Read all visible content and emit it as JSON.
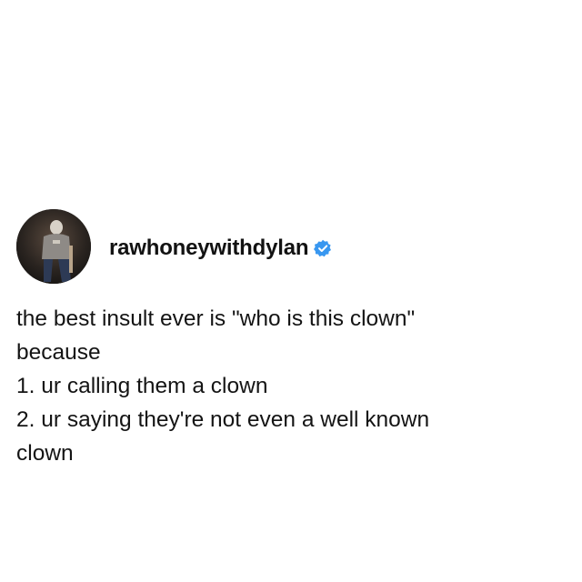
{
  "post": {
    "username": "rawhoneywithdylan",
    "verified": true,
    "verified_color": "#3897f0",
    "avatar_icon": "profile-photo",
    "lines": [
      "the best insult ever is \"who is this clown\"",
      "because",
      "1. ur calling them a clown",
      "2. ur saying they're not even a well known",
      "clown"
    ]
  }
}
